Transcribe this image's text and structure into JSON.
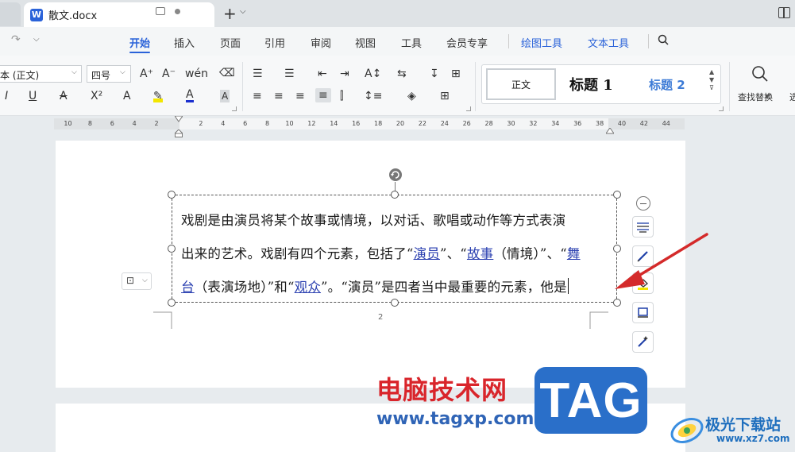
{
  "titlebar": {
    "doc_name": "散文.docx",
    "app_icon_letter": "W"
  },
  "menu": {
    "items": [
      "开始",
      "插入",
      "页面",
      "引用",
      "审阅",
      "视图",
      "工具",
      "会员专享"
    ],
    "context_items": [
      "绘图工具",
      "文本工具"
    ],
    "active": "开始"
  },
  "ribbon": {
    "font_name": "本 (正文)",
    "font_size": "四号",
    "style_normal": "正文",
    "style_h1": "标题 1",
    "style_h2": "标题 2",
    "find_replace": "查找替换",
    "find_more": "选"
  },
  "ruler": {
    "labels": [
      "10",
      "8",
      "6",
      "4",
      "2",
      "2",
      "4",
      "6",
      "8",
      "10",
      "12",
      "14",
      "16",
      "18",
      "20",
      "22",
      "24",
      "26",
      "28",
      "30",
      "32",
      "34",
      "36",
      "38",
      "40",
      "42",
      "44"
    ]
  },
  "document": {
    "line1": "戏剧是由演员将某个故事或情境，以对话、歌唱或动作等方式表演",
    "line2_a": "出来的艺术。戏剧有四个元素，包括了“",
    "link1": "演员",
    "line2_b": "”、“",
    "link2": "故事",
    "line2_c": "（情境）”、“",
    "link3a": "舞",
    "link3b": "台",
    "line3_a": "（表演场地）”和“",
    "link4": "观众",
    "line3_b": "”。“演员”是四者当中最重要的元素，他是",
    "page_number": "2"
  },
  "watermarks": {
    "site_cn": "电脑技术网",
    "site_url": "www.tagxp.com",
    "tag": "TAG",
    "jg_name": "极光下载站",
    "jg_url": "www.xz7.com"
  },
  "colors": {
    "accent": "#2a62d9",
    "arrow": "#d42a2a",
    "watermark_red": "#d9252b"
  }
}
